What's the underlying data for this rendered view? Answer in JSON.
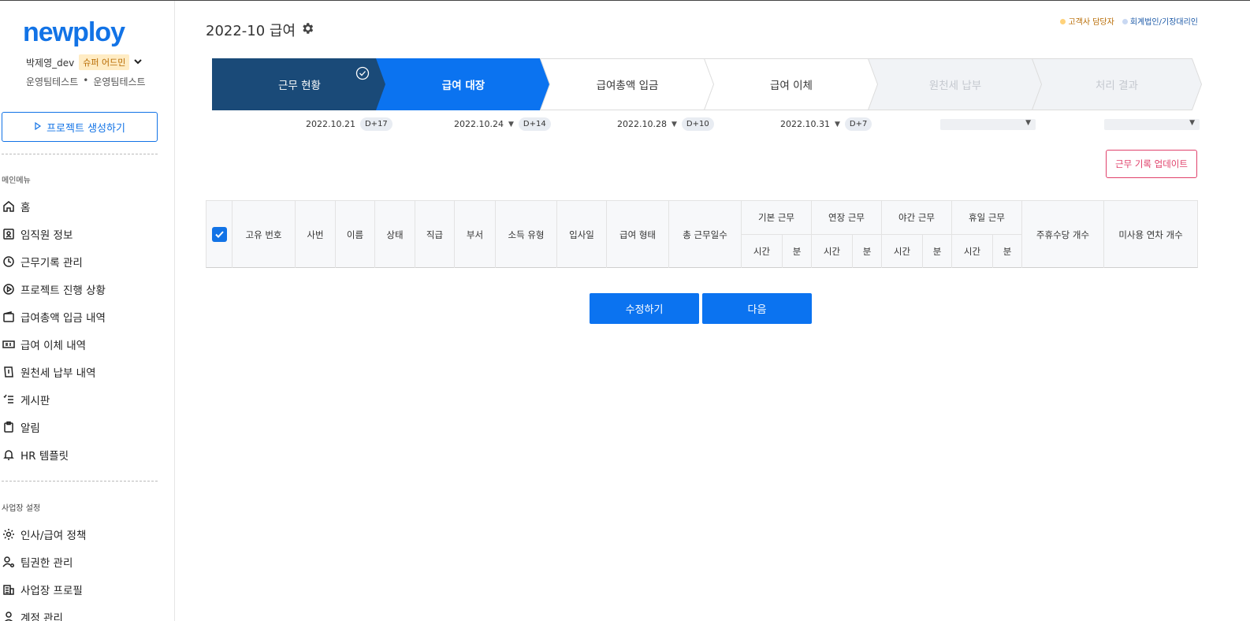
{
  "sidebar": {
    "logo": "newploy",
    "user_name": "박제영_dev",
    "role_badge": "슈퍼 어드민",
    "team_a": "운영팀테스트",
    "team_sep": "•",
    "team_b": "운영팀테스트",
    "create_project_label": "프로젝트 생성하기",
    "main_menu_title": "메인메뉴",
    "main_items": [
      {
        "label": "홈",
        "icon": "home-icon"
      },
      {
        "label": "임직원 정보",
        "icon": "id-card-icon"
      },
      {
        "label": "근무기록 관리",
        "icon": "clock-icon"
      },
      {
        "label": "프로젝트 진행 상황",
        "icon": "play-circle-icon"
      },
      {
        "label": "급여총액 입금 내역",
        "icon": "wallet-icon"
      },
      {
        "label": "급여 이체 내역",
        "icon": "transfer-icon"
      },
      {
        "label": "원천세 납부 내역",
        "icon": "tax-doc-icon"
      },
      {
        "label": "게시판",
        "icon": "checklist-icon"
      },
      {
        "label": "알림",
        "icon": "clipboard-icon"
      },
      {
        "label": "HR 템플릿",
        "icon": "bell-icon"
      }
    ],
    "settings_title": "사업장 설정",
    "settings_items": [
      {
        "label": "인사/급여 정책",
        "icon": "gear-icon"
      },
      {
        "label": "팀권한 관리",
        "icon": "user-gear-icon"
      },
      {
        "label": "사업장 프로필",
        "icon": "building-icon"
      },
      {
        "label": "계정 관리",
        "icon": "user-icon"
      }
    ]
  },
  "header": {
    "title": "2022-10 급여",
    "legend_client": "고객사 담당자",
    "legend_accounting": "회계법인/기장대리인",
    "legend_client_color": "#ffd27a",
    "legend_accounting_color": "#c9d8f2"
  },
  "steps": [
    {
      "label": "근무 현황",
      "state": "done"
    },
    {
      "label": "급여 대장",
      "state": "active"
    },
    {
      "label": "급여총액 입금",
      "state": "pending"
    },
    {
      "label": "급여 이체",
      "state": "pending"
    },
    {
      "label": "원천세 납부",
      "state": "disabled"
    },
    {
      "label": "처리 결과",
      "state": "disabled"
    }
  ],
  "dates": [
    {
      "date": "2022.10.21",
      "dday": "D+17"
    },
    {
      "date": "2022.10.24",
      "dday": "D+14"
    },
    {
      "date": "2022.10.28",
      "dday": "D+10"
    },
    {
      "date": "2022.10.31",
      "dday": "D+7"
    }
  ],
  "update_button": "근무 기록 업데이트",
  "table": {
    "columns": [
      "고유 번호",
      "사번",
      "이름",
      "상태",
      "직급",
      "부서",
      "소득 유형",
      "입사일",
      "급여 형태",
      "총 근무일수"
    ],
    "group_columns": [
      "기본 근무",
      "연장 근무",
      "야간 근무",
      "휴일 근무"
    ],
    "sub_hour": "시간",
    "sub_min": "분",
    "tail_columns": [
      "주휴수당 개수",
      "미사용 연차 개수"
    ]
  },
  "actions": {
    "edit": "수정하기",
    "next": "다음"
  },
  "colors": {
    "brand": "#1273e6",
    "step_done": "#1a4a78",
    "step_active": "#0b73f0",
    "danger": "#e0416b"
  }
}
